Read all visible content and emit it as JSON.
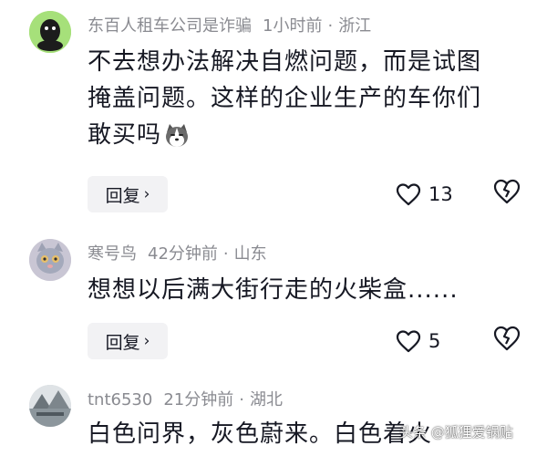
{
  "comments": [
    {
      "username": "东百人租车公司是诈骗",
      "time": "1小时前",
      "location": "浙江",
      "text_line1": "不去想办法解决自燃问题，而是试图",
      "text_line2": "掩盖问题。这样的企业生产的车你们",
      "text_line3": "敢买吗",
      "emoji": "husky-emoji",
      "reply_label": "回复",
      "likes": "13"
    },
    {
      "username": "寒号鸟",
      "time": "42分钟前",
      "location": "山东",
      "text_line1": "想想以后满大街行走的火柴盒......",
      "reply_label": "回复",
      "likes": "5"
    },
    {
      "username": "tnt6530",
      "time": "21分钟前",
      "location": "湖北",
      "text_line1": "白色问界，灰色蔚来。白色着火"
    }
  ],
  "watermark": "头条 @狐狸爱锅贴",
  "colors": {
    "meta": "#8a8b91",
    "text": "#161823",
    "reply_bg": "#f2f2f4"
  }
}
